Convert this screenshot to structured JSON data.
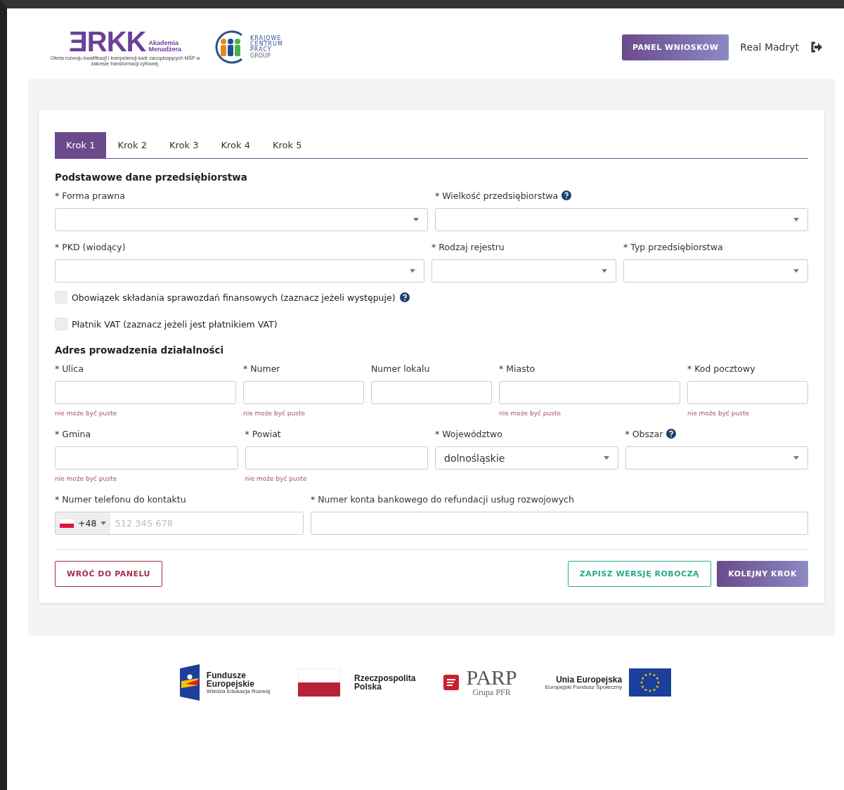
{
  "header": {
    "orkk_logo": {
      "mark": "ƎRKK",
      "name_lines": [
        "Akademia",
        "Menadżera"
      ],
      "tagline": "Oferta rozwoju kwalifikacji i kompetencji kadr zarządzających MŚP w zakresie transformacji cyfrowej."
    },
    "kcp_logo": {
      "lines": [
        "KRAJOWE",
        "CENTRUM",
        "PRACY"
      ],
      "sub": "GROUP"
    },
    "panel_button": "PANEL WNIOSKÓW",
    "user_name": "Real Madryt"
  },
  "tabs": [
    {
      "label": "Krok 1",
      "selected": true
    },
    {
      "label": "Krok 2",
      "selected": false
    },
    {
      "label": "Krok 3",
      "selected": false
    },
    {
      "label": "Krok 4",
      "selected": false
    },
    {
      "label": "Krok 5",
      "selected": false
    }
  ],
  "sections": [
    {
      "title": "Podstawowe dane przedsiębiorstwa",
      "rows": [
        {
          "kind": "fields",
          "fields": [
            {
              "kind": "select",
              "label": "* Forma prawna",
              "help": false
            },
            {
              "kind": "select",
              "label": "* Wielkość przedsiębiorstwa",
              "help": true
            }
          ]
        },
        {
          "kind": "fields",
          "fields": [
            {
              "kind": "select",
              "label": "* PKD (wiodący)",
              "help": false
            },
            {
              "kind": "select",
              "label": "* Rodzaj rejestru",
              "help": false
            },
            {
              "kind": "select",
              "label": "* Typ przedsiębiorstwa",
              "help": false
            }
          ]
        },
        {
          "kind": "checkbox",
          "label": "Obowiązek składania sprawozdań finansowych (zaznacz jeżeli występuje)",
          "checked": false,
          "help": true
        },
        {
          "kind": "checkbox",
          "label": "Płatnik VAT (zaznacz jeżeli jest płatnikiem VAT)",
          "checked": false,
          "help": false
        }
      ]
    },
    {
      "title": "Adres prowadzenia działalności",
      "rows": [
        {
          "kind": "fields",
          "fields": [
            {
              "kind": "text",
              "label": "* Ulica",
              "help": false,
              "error": "nie może być puste"
            },
            {
              "kind": "text",
              "label": "* Numer",
              "help": false,
              "error": "nie może być puste"
            },
            {
              "kind": "text",
              "label": "Numer lokalu",
              "help": false
            },
            {
              "kind": "text",
              "label": "* Miasto",
              "help": false,
              "error": "nie może być puste"
            },
            {
              "kind": "text",
              "label": "* Kod pocztowy",
              "help": false,
              "error": "nie może być puste"
            }
          ]
        },
        {
          "kind": "fields",
          "fields": [
            {
              "kind": "text",
              "label": "* Gmina",
              "help": false,
              "error": "nie może być puste"
            },
            {
              "kind": "text",
              "label": "* Powiat",
              "help": false,
              "error": "nie może być puste"
            },
            {
              "kind": "select",
              "label": "* Województwo",
              "help": false,
              "value": "dolnośląskie"
            },
            {
              "kind": "select",
              "label": "* Obszar",
              "help": true
            }
          ]
        },
        {
          "kind": "fields",
          "fields": [
            {
              "kind": "phone",
              "label": "* Numer telefonu do kontaktu",
              "help": false,
              "dial_code": "+48",
              "placeholder": "512 345 678"
            },
            {
              "kind": "text",
              "label": "* Numer konta bankowego do refundacji usług rozwojowych",
              "help": false
            }
          ]
        }
      ]
    }
  ],
  "buttons": {
    "back": "WRÓĆ DO PANELU",
    "draft": "ZAPISZ WERSJĘ ROBOCZĄ",
    "next": "KOLEJNY KROK"
  },
  "footer": {
    "fe": {
      "lines": [
        "Fundusze",
        "Europejskie"
      ],
      "sub": "Wiedza Edukacja Rozwój"
    },
    "rp": {
      "lines": [
        "Rzeczpospolita",
        "Polska"
      ]
    },
    "parp": {
      "name": "PARP",
      "sub": "Grupa PFR"
    },
    "ue": {
      "name": "Unia Europejska",
      "sub": "Europejski Fundusz Społeczny"
    }
  }
}
